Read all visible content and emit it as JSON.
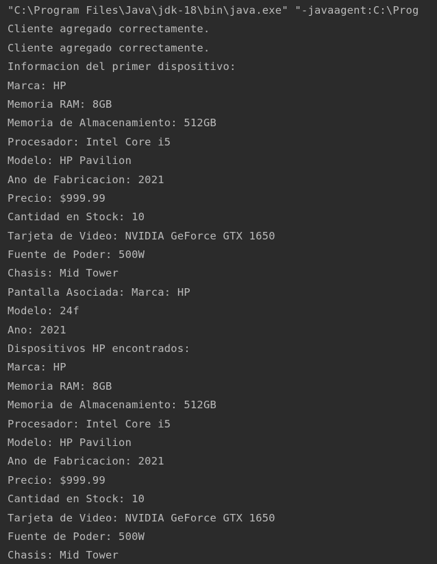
{
  "console": {
    "lines": [
      "\"C:\\Program Files\\Java\\jdk-18\\bin\\java.exe\" \"-javaagent:C:\\Prog",
      "Cliente agregado correctamente.",
      "Cliente agregado correctamente.",
      "Informacion del primer dispositivo:",
      "Marca: HP",
      "Memoria RAM: 8GB",
      "Memoria de Almacenamiento: 512GB",
      "Procesador: Intel Core i5",
      "Modelo: HP Pavilion",
      "Ano de Fabricacion: 2021",
      "Precio: $999.99",
      "Cantidad en Stock: 10",
      "Tarjeta de Video: NVIDIA GeForce GTX 1650",
      "Fuente de Poder: 500W",
      "Chasis: Mid Tower",
      "Pantalla Asociada: Marca: HP",
      "Modelo: 24f",
      "Ano: 2021",
      "Dispositivos HP encontrados:",
      "Marca: HP",
      "Memoria RAM: 8GB",
      "Memoria de Almacenamiento: 512GB",
      "Procesador: Intel Core i5",
      "Modelo: HP Pavilion",
      "Ano de Fabricacion: 2021",
      "Precio: $999.99",
      "Cantidad en Stock: 10",
      "Tarjeta de Video: NVIDIA GeForce GTX 1650",
      "Fuente de Poder: 500W",
      "Chasis: Mid Tower"
    ]
  },
  "colors": {
    "background": "#2b2b2b",
    "text": "#bbbbbb"
  }
}
